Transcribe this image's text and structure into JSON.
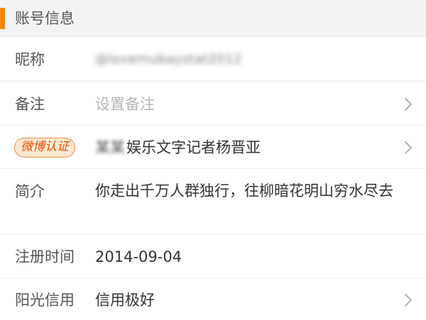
{
  "section": {
    "title": "账号信息",
    "accent_color": "#ff8200"
  },
  "rows": {
    "nickname": {
      "label": "昵称",
      "value": "@lovemubaystat2012"
    },
    "remark": {
      "label": "备注",
      "placeholder": "设置备注"
    },
    "verified": {
      "badge": "微博认证",
      "value_prefix_blurred": "某某",
      "value": "娱乐文字记者杨晋亚"
    },
    "bio": {
      "label": "简介",
      "value": "你走出千万人群独行，往柳暗花明山穷水尽去"
    },
    "register_time": {
      "label": "注册时间",
      "value": "2014-09-04"
    },
    "credit": {
      "label": "阳光信用",
      "value": "信用极好"
    }
  },
  "icons": {
    "chevron": "chevron-right-icon"
  }
}
